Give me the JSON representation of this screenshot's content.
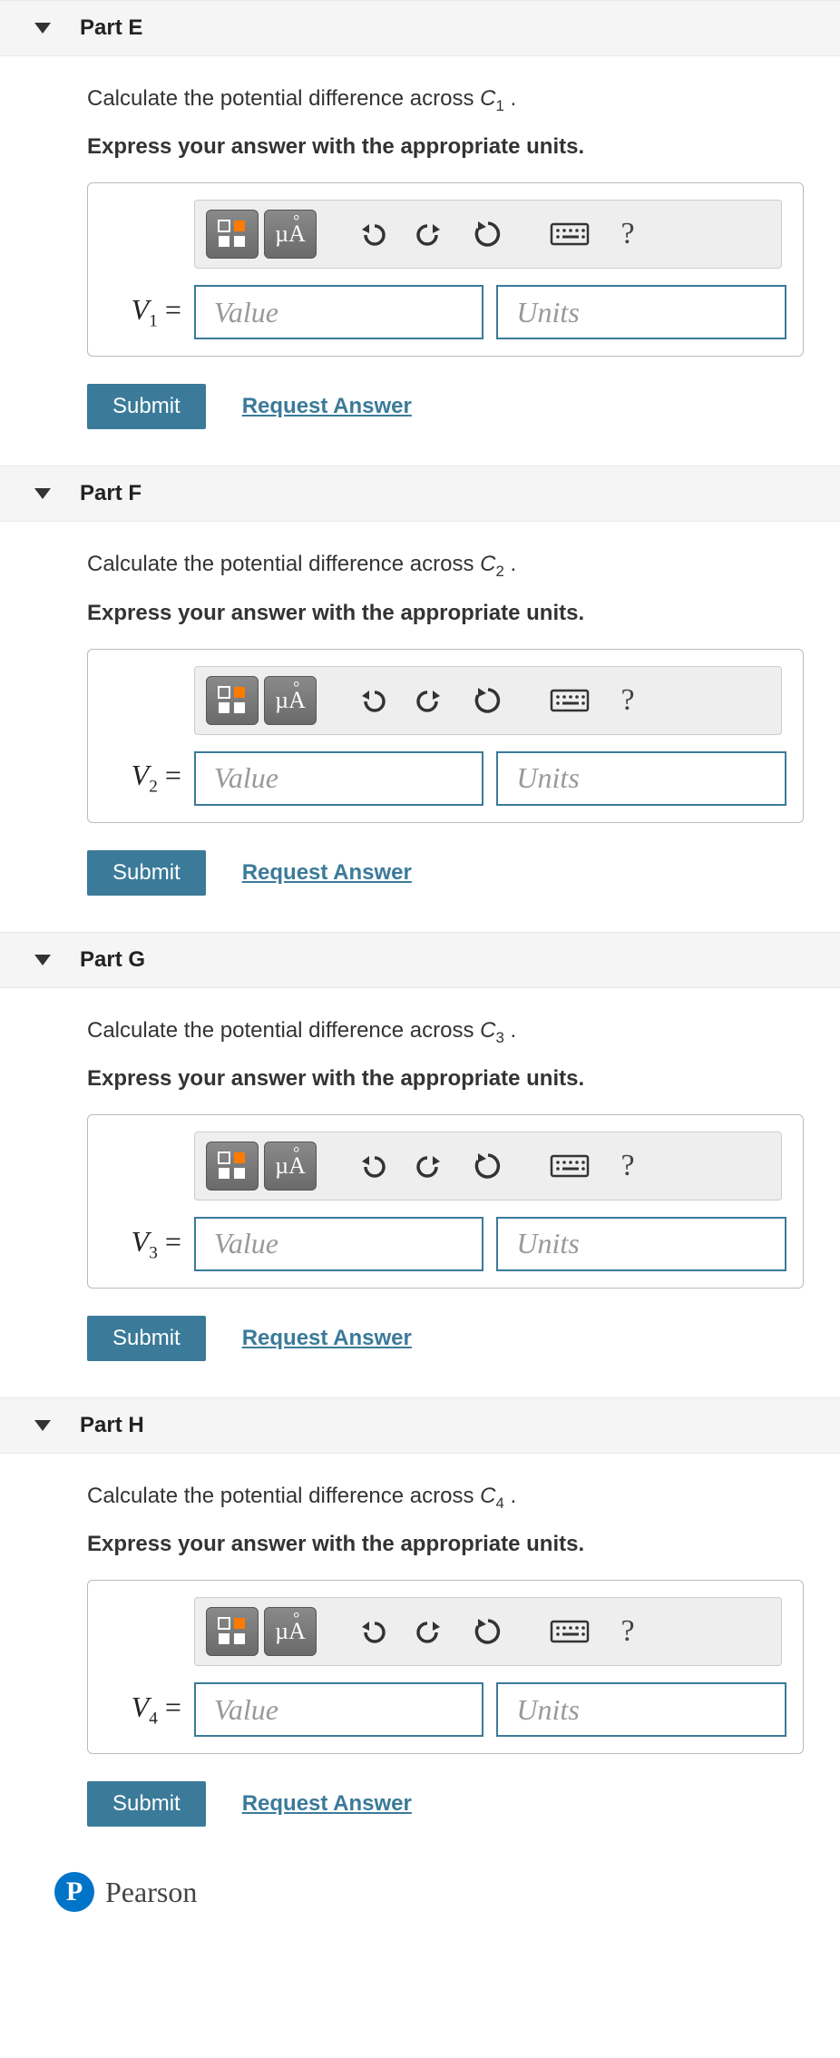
{
  "parts": [
    {
      "id": "E",
      "title": "Part E",
      "varBase": "V",
      "sub": "1",
      "capSub": "1",
      "promptPre": "Calculate the potential difference across ",
      "promptPost": " .",
      "instr": "Express your answer with the appropriate units.",
      "valuePH": "Value",
      "unitsPH": "Units",
      "submit": "Submit",
      "request": "Request Answer"
    },
    {
      "id": "F",
      "title": "Part F",
      "varBase": "V",
      "sub": "2",
      "capSub": "2",
      "promptPre": "Calculate the potential difference across ",
      "promptPost": " .",
      "instr": "Express your answer with the appropriate units.",
      "valuePH": "Value",
      "unitsPH": "Units",
      "submit": "Submit",
      "request": "Request Answer"
    },
    {
      "id": "G",
      "title": "Part G",
      "varBase": "V",
      "sub": "3",
      "capSub": "3",
      "promptPre": "Calculate the potential difference across ",
      "promptPost": " .",
      "instr": "Express your answer with the appropriate units.",
      "valuePH": "Value",
      "unitsPH": "Units",
      "submit": "Submit",
      "request": "Request Answer"
    },
    {
      "id": "H",
      "title": "Part H",
      "varBase": "V",
      "sub": "4",
      "capSub": "4",
      "promptPre": "Calculate the potential difference across ",
      "promptPost": " .",
      "instr": "Express your answer with the appropriate units.",
      "valuePH": "Value",
      "unitsPH": "Units",
      "submit": "Submit",
      "request": "Request Answer"
    }
  ],
  "toolbar": {
    "unitsGlyph": "µÅ"
  },
  "footer": {
    "brand": "Pearson",
    "logo": "P"
  }
}
